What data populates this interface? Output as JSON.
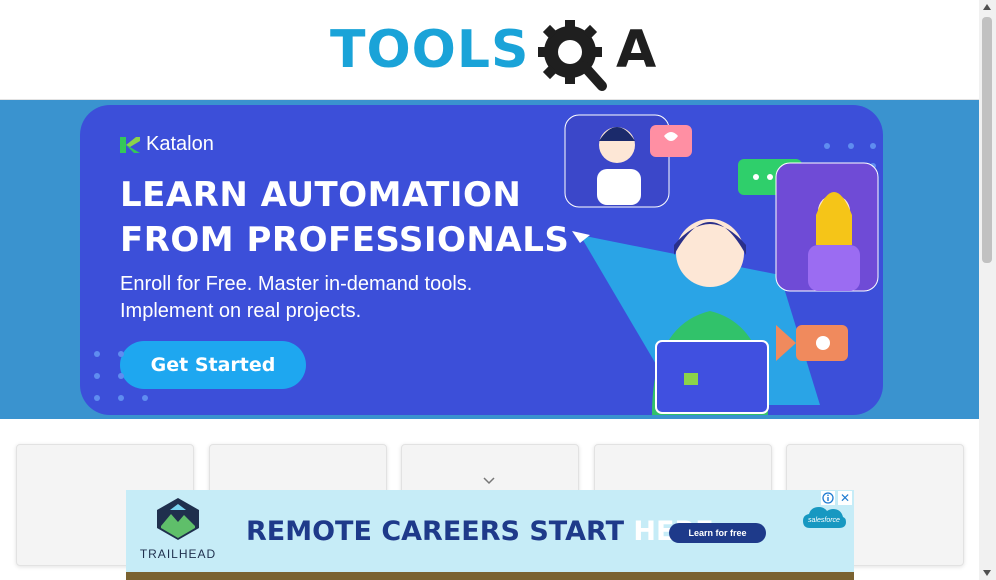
{
  "header": {
    "logo_main": "TOOLS",
    "logo_accent": "A"
  },
  "banner": {
    "brand": "Katalon",
    "headline_line1": "LEARN AUTOMATION",
    "headline_line2": "FROM PROFESSIONALS",
    "sub_line1": "Enroll for Free. Master in-demand tools.",
    "sub_line2": "Implement on real projects.",
    "cta_label": "Get Started"
  },
  "ad": {
    "brand": "TRAILHEAD",
    "headline_main": "REMOTE CAREERS START ",
    "headline_highlight": "HERE.",
    "cta_label": "Learn for free",
    "sponsor": "salesforce",
    "close_label": "✕"
  },
  "colors": {
    "brand_blue": "#1aa3d8",
    "banner_bg": "#3c4fd9",
    "band_bg": "#3a93cf",
    "cta_bg": "#1ea7f0",
    "ad_bg": "#c6ecf7"
  },
  "icons": [
    "gear-magnifier-icon",
    "katalon-logo-icon",
    "chevron-down-icon",
    "adchoices-icon",
    "close-icon",
    "trailhead-logo-icon",
    "salesforce-cloud-icon"
  ]
}
